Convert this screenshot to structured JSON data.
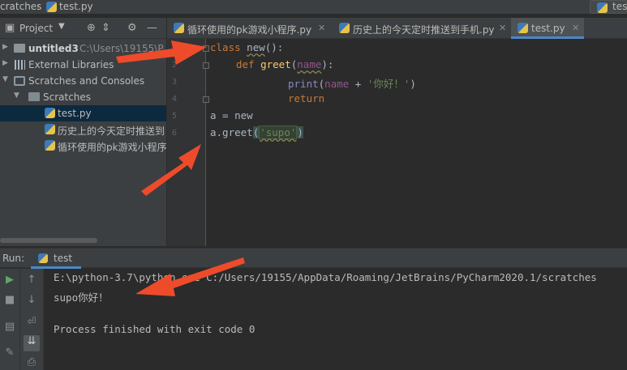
{
  "breadcrumb": {
    "folder": "cratches",
    "file": "test.py",
    "right_label": "tes"
  },
  "project": {
    "title": "Project",
    "tree": [
      {
        "name": "untitled3",
        "path": "C:\\Users\\19155\\P"
      },
      {
        "name": "External Libraries"
      },
      {
        "name": "Scratches and Consoles"
      },
      {
        "name": "Scratches"
      },
      {
        "name": "test.py"
      },
      {
        "name": "历史上的今天定时推送到"
      },
      {
        "name": "循环使用的pk游戏小程序"
      }
    ]
  },
  "tabs": [
    {
      "label": "循环使用的pk游戏小程序.py"
    },
    {
      "label": "历史上的今天定时推送到手机.py"
    },
    {
      "label": "test.py",
      "active": true
    }
  ],
  "editor": {
    "line_numbers": [
      "1",
      "2",
      "3",
      "4",
      "5",
      "6"
    ],
    "code": {
      "l1_kw": "class",
      "l1_name": "new",
      "l1_rest": "():",
      "l2_kw": "def",
      "l2_name": "greet",
      "l2_open": "(",
      "l2_param": "name",
      "l2_close": "):",
      "l3_fn": "print",
      "l3_open": "(",
      "l3_arg": "name",
      "l3_op": " + ",
      "l3_str": "'你好！'",
      "l3_close": ")",
      "l4_kw": "return",
      "l5": "a = new",
      "l6_pre": "a.greet",
      "l6_open": "(",
      "l6_str": "'supo'",
      "l6_close": ")"
    }
  },
  "run": {
    "label": "Run:",
    "tab": "test",
    "console": [
      "E:\\python-3.7\\python.exe C:/Users/19155/AppData/Roaming/JetBrains/PyCharm2020.1/scratches",
      "supo你好！",
      "",
      "Process finished with exit code 0"
    ]
  },
  "colors": {
    "arrow": "#ee4b2b",
    "keyword": "#cc7832",
    "function": "#ffc66d",
    "string": "#6a8759",
    "accent": "#4a88c7"
  }
}
